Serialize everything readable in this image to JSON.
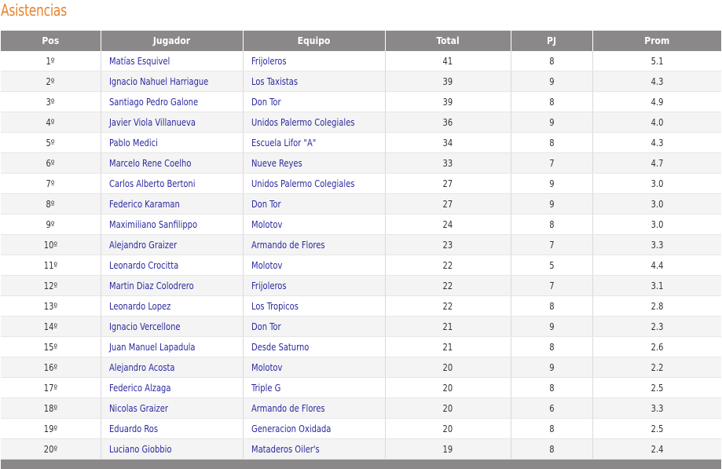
{
  "title": "Asistencias",
  "table": {
    "headers": {
      "pos": "Pos",
      "player": "Jugador",
      "team": "Equipo",
      "total": "Total",
      "pj": "PJ",
      "prom": "Prom"
    },
    "rows": [
      {
        "pos": "1º",
        "player": "Matías Esquivel",
        "team": "Frijoleros",
        "total": "41",
        "pj": "8",
        "prom": "5.1"
      },
      {
        "pos": "2º",
        "player": "Ignacio Nahuel Harriague",
        "team": "Los Taxistas",
        "total": "39",
        "pj": "9",
        "prom": "4.3"
      },
      {
        "pos": "3º",
        "player": "Santiago Pedro Galone",
        "team": "Don Tor",
        "total": "39",
        "pj": "8",
        "prom": "4.9"
      },
      {
        "pos": "4º",
        "player": "Javier Viola Villanueva",
        "team": "Unidos Palermo Colegiales",
        "total": "36",
        "pj": "9",
        "prom": "4.0"
      },
      {
        "pos": "5º",
        "player": "Pablo Medici",
        "team": "Escuela Lifor \"A\"",
        "total": "34",
        "pj": "8",
        "prom": "4.3"
      },
      {
        "pos": "6º",
        "player": "Marcelo Rene Coelho",
        "team": "Nueve Reyes",
        "total": "33",
        "pj": "7",
        "prom": "4.7"
      },
      {
        "pos": "7º",
        "player": "Carlos Alberto Bertoni",
        "team": "Unidos Palermo Colegiales",
        "total": "27",
        "pj": "9",
        "prom": "3.0"
      },
      {
        "pos": "8º",
        "player": "Federico Karaman",
        "team": "Don Tor",
        "total": "27",
        "pj": "9",
        "prom": "3.0"
      },
      {
        "pos": "9º",
        "player": "Maximiliano Sanfilippo",
        "team": "Molotov",
        "total": "24",
        "pj": "8",
        "prom": "3.0"
      },
      {
        "pos": "10º",
        "player": "Alejandro Graizer",
        "team": "Armando de Flores",
        "total": "23",
        "pj": "7",
        "prom": "3.3"
      },
      {
        "pos": "11º",
        "player": "Leonardo Crocitta",
        "team": "Molotov",
        "total": "22",
        "pj": "5",
        "prom": "4.4"
      },
      {
        "pos": "12º",
        "player": "Martin Diaz Colodrero",
        "team": "Frijoleros",
        "total": "22",
        "pj": "7",
        "prom": "3.1"
      },
      {
        "pos": "13º",
        "player": "Leonardo Lopez",
        "team": "Los Tropicos",
        "total": "22",
        "pj": "8",
        "prom": "2.8"
      },
      {
        "pos": "14º",
        "player": "Ignacio Vercellone",
        "team": "Don Tor",
        "total": "21",
        "pj": "9",
        "prom": "2.3"
      },
      {
        "pos": "15º",
        "player": "Juan Manuel Lapadula",
        "team": "Desde Saturno",
        "total": "21",
        "pj": "8",
        "prom": "2.6"
      },
      {
        "pos": "16º",
        "player": "Alejandro Acosta",
        "team": "Molotov",
        "total": "20",
        "pj": "9",
        "prom": "2.2"
      },
      {
        "pos": "17º",
        "player": "Federico Alzaga",
        "team": "Triple G",
        "total": "20",
        "pj": "8",
        "prom": "2.5"
      },
      {
        "pos": "18º",
        "player": "Nicolas Graizer",
        "team": "Armando de Flores",
        "total": "20",
        "pj": "6",
        "prom": "3.3"
      },
      {
        "pos": "19º",
        "player": "Eduardo Ros",
        "team": "Generacion Oxidada",
        "total": "20",
        "pj": "8",
        "prom": "2.5"
      },
      {
        "pos": "20º",
        "player": "Luciano Giobbio",
        "team": "Mataderos Oiler's",
        "total": "19",
        "pj": "8",
        "prom": "2.4"
      }
    ]
  },
  "colors": {
    "title": "#e8832a",
    "header_bg": "#8b8889",
    "link": "#2a2aa0",
    "stripe": "#f4f4f4"
  }
}
